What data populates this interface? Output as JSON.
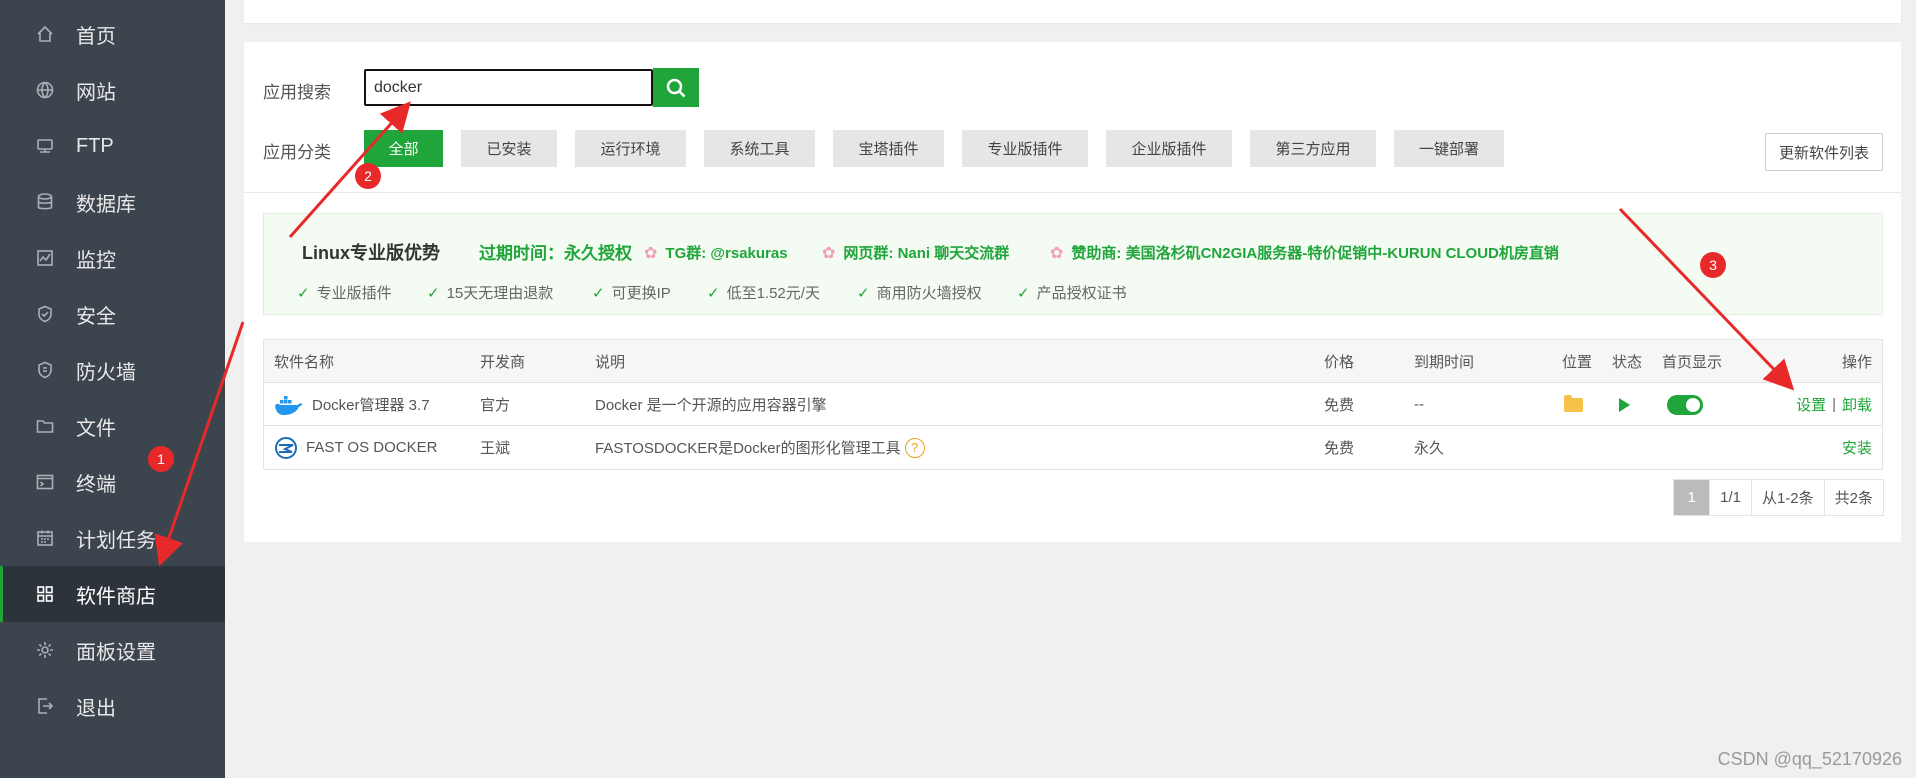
{
  "sidebar": {
    "items": [
      {
        "label": "首页",
        "icon": "home-icon"
      },
      {
        "label": "网站",
        "icon": "globe-icon"
      },
      {
        "label": "FTP",
        "icon": "ftp-icon"
      },
      {
        "label": "数据库",
        "icon": "database-icon"
      },
      {
        "label": "监控",
        "icon": "monitor-icon"
      },
      {
        "label": "安全",
        "icon": "shield-icon"
      },
      {
        "label": "防火墙",
        "icon": "firewall-icon"
      },
      {
        "label": "文件",
        "icon": "folder-icon"
      },
      {
        "label": "终端",
        "icon": "terminal-icon"
      },
      {
        "label": "计划任务",
        "icon": "calendar-icon"
      },
      {
        "label": "软件商店",
        "icon": "grid-icon"
      },
      {
        "label": "面板设置",
        "icon": "gear-icon"
      },
      {
        "label": "退出",
        "icon": "logout-icon"
      }
    ],
    "active_index": 10
  },
  "search": {
    "label": "应用搜索",
    "value": "docker"
  },
  "category": {
    "label": "应用分类",
    "items": [
      "全部",
      "已安装",
      "运行环境",
      "系统工具",
      "宝塔插件",
      "专业版插件",
      "企业版插件",
      "第三方应用",
      "一键部署"
    ],
    "active_index": 0,
    "update_label": "更新软件列表"
  },
  "banner": {
    "title": "Linux专业版优势",
    "expire": "过期时间：永久授权",
    "links": [
      "TG群: @rsakuras",
      "网页群: Nani 聊天交流群",
      "赞助商: 美国洛杉矶CN2GIA服务器-特价促销中-KURUN CLOUD机房直销"
    ],
    "features": [
      "专业版插件",
      "15天无理由退款",
      "可更换IP",
      "低至1.52元/天",
      "商用防火墙授权",
      "产品授权证书"
    ]
  },
  "table": {
    "headers": {
      "name": "软件名称",
      "developer": "开发商",
      "desc": "说明",
      "price": "价格",
      "expire": "到期时间",
      "location": "位置",
      "status": "状态",
      "homepage": "首页显示",
      "ops": "操作"
    },
    "rows": [
      {
        "name": "Docker管理器 3.7",
        "icon": "docker-whale-icon",
        "developer": "官方",
        "desc": "Docker 是一个开源的应用容器引擎",
        "price": "免费",
        "expire": "--",
        "homepage_on": true,
        "ops": [
          "设置",
          "卸载"
        ]
      },
      {
        "name": "FAST OS DOCKER",
        "icon": "fastos-icon",
        "developer": "王斌",
        "desc": "FASTOSDOCKER是Docker的图形化管理工具",
        "price": "免费",
        "expire": "永久",
        "ops": [
          "安装"
        ]
      }
    ]
  },
  "pagination": {
    "current": "1",
    "pages": "1/1",
    "range": "从1-2条",
    "total": "共2条"
  },
  "annotations": {
    "badges": [
      "1",
      "2",
      "3"
    ],
    "color": "#e8292a"
  },
  "watermark": "CSDN @qq_52170926",
  "colors": {
    "sidebar_bg": "#3c444d",
    "accent": "#20a53a",
    "annotation": "#e8292a"
  }
}
